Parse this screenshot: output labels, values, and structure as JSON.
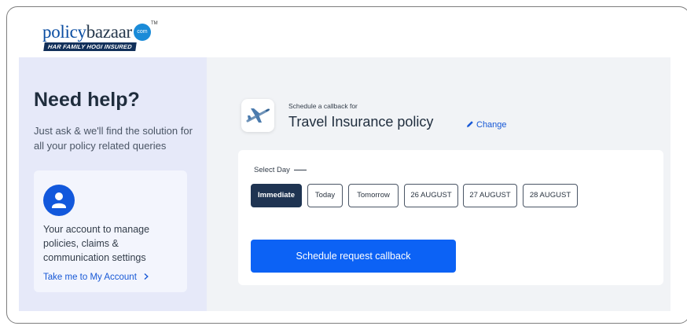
{
  "brand": {
    "word_policy": "policy",
    "word_bazaar": "bazaar",
    "dot_com": "com",
    "tm": "TM",
    "tagline": "HAR FAMILY HOGI INSURED",
    "colors": {
      "policy": "#0a4da2",
      "bazaar": "#26384c",
      "dot": "#1a8bd8",
      "tag_bg": "#12305a"
    }
  },
  "help": {
    "title": "Need help?",
    "subtitle": "Just ask & we'll find the solution for all your policy related queries",
    "account_text": "Your account to manage policies, claims & communication settings",
    "account_link": "Take me to My Account",
    "link_icon": "chevron-right-icon",
    "avatar_icon": "user-icon"
  },
  "callback": {
    "label": "Schedule a callback for",
    "policy_name": "Travel Insurance policy",
    "change_label": "Change",
    "plane_icon": "airplane-icon",
    "edit_icon": "pencil-icon"
  },
  "schedule": {
    "select_day_label": "Select Day",
    "days": [
      "Immediate",
      "Today",
      "Tomorrow",
      "26 AUGUST",
      "27 AUGUST",
      "28 AUGUST"
    ],
    "selected_day": "Immediate",
    "cta_label": "Schedule request callback"
  },
  "colors": {
    "accent": "#0c62f5",
    "selected_day_bg": "#1f3452",
    "help_panel_bg": "#e6e9f9",
    "content_bg": "#f1f3f6",
    "link": "#1758d6"
  }
}
